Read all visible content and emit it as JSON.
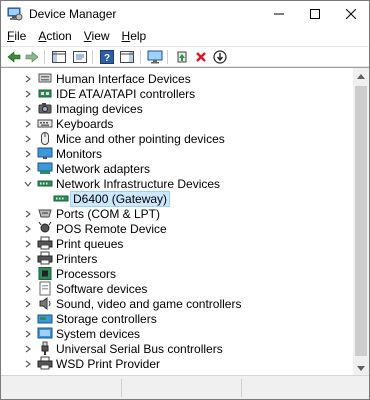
{
  "window": {
    "title": "Device Manager"
  },
  "menu": [
    {
      "access": "F",
      "rest": "ile"
    },
    {
      "access": "A",
      "rest": "ction"
    },
    {
      "access": "V",
      "rest": "iew"
    },
    {
      "access": "H",
      "rest": "elp"
    }
  ],
  "toolbar": {
    "icons": [
      "back-icon",
      "forward-icon",
      "show-hide-console-tree-icon",
      "properties-icon",
      "help-icon",
      "action-pane-icon",
      "monitor-icon",
      "update-driver-icon",
      "uninstall-icon",
      "scan-hardware-icon"
    ]
  },
  "tree": {
    "items": [
      {
        "label": "Human Interface Devices",
        "icon": "hid-icon",
        "expanded": false
      },
      {
        "label": "IDE ATA/ATAPI controllers",
        "icon": "ide-controller-icon",
        "expanded": false
      },
      {
        "label": "Imaging devices",
        "icon": "camera-icon",
        "expanded": false
      },
      {
        "label": "Keyboards",
        "icon": "keyboard-icon",
        "expanded": false
      },
      {
        "label": "Mice and other pointing devices",
        "icon": "mouse-icon",
        "expanded": false
      },
      {
        "label": "Monitors",
        "icon": "monitor-icon",
        "expanded": false
      },
      {
        "label": "Network adapters",
        "icon": "network-adapter-icon",
        "expanded": false
      },
      {
        "label": "Network Infrastructure Devices",
        "icon": "network-infrastructure-icon",
        "expanded": true
      },
      {
        "label": "D6400 (Gateway)",
        "icon": "gateway-icon",
        "child": true,
        "selected": true
      },
      {
        "label": "Ports (COM & LPT)",
        "icon": "port-icon",
        "expanded": false
      },
      {
        "label": "POS Remote Device",
        "icon": "pos-device-icon",
        "expanded": false
      },
      {
        "label": "Print queues",
        "icon": "printer-icon",
        "expanded": false
      },
      {
        "label": "Printers",
        "icon": "printer-icon",
        "expanded": false
      },
      {
        "label": "Processors",
        "icon": "processor-icon",
        "expanded": false
      },
      {
        "label": "Software devices",
        "icon": "software-device-icon",
        "expanded": false
      },
      {
        "label": "Sound, video and game controllers",
        "icon": "speaker-icon",
        "expanded": false
      },
      {
        "label": "Storage controllers",
        "icon": "storage-controller-icon",
        "expanded": false
      },
      {
        "label": "System devices",
        "icon": "system-device-icon",
        "expanded": false
      },
      {
        "label": "Universal Serial Bus controllers",
        "icon": "usb-icon",
        "expanded": false
      },
      {
        "label": "WSD Print Provider",
        "icon": "printer-icon",
        "expanded": false
      }
    ]
  },
  "colors": {
    "selection_bg": "#cce8ff",
    "selection_border": "#99d1ff",
    "uninstall_red": "#e81123",
    "update_green": "#1d9a3a"
  }
}
